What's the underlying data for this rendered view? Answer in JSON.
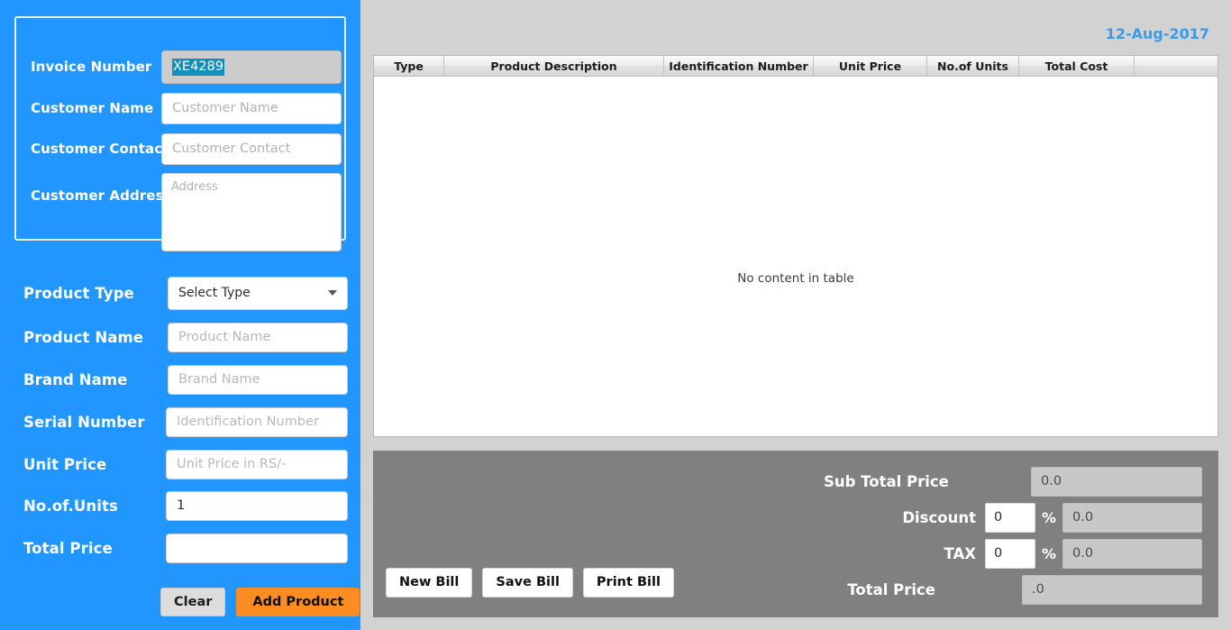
{
  "theme": {
    "sidebar_blue": "#2196ff",
    "accent_orange": "#fd8d20",
    "panel_gray": "#808080",
    "background_gray": "#d2d2d2",
    "date_blue": "#3d9ae8",
    "selection_teal": "#1290bd"
  },
  "customer": {
    "invoice_label": "Invoice Number",
    "invoice_value": "XE4289",
    "name_label": "Customer Name",
    "name_value": "",
    "name_placeholder": "Customer Name",
    "contact_label": "Customer Contact",
    "contact_value": "",
    "contact_placeholder": "Customer Contact",
    "address_label": "Customer Address",
    "address_value": "",
    "address_placeholder": "Address"
  },
  "product": {
    "type_label": "Product Type",
    "type_selected": "Select Type",
    "name_label": "Product Name",
    "name_value": "",
    "name_placeholder": "Product Name",
    "brand_label": "Brand Name",
    "brand_value": "",
    "brand_placeholder": "Brand Name",
    "serial_label": "Serial Number",
    "serial_value": "",
    "serial_placeholder": "Identification Number",
    "unit_price_label": "Unit Price",
    "unit_price_value": "",
    "unit_price_placeholder": "Unit Price in RS/-",
    "units_label": "No.of.Units",
    "units_value": "1",
    "units_placeholder": "",
    "total_price_label": "Total Price",
    "total_price_value": "",
    "total_price_placeholder": "",
    "clear_label": "Clear",
    "add_label": "Add Product"
  },
  "bill": {
    "date": "12-Aug-2017",
    "empty_message": "No content in table",
    "new_label": "New Bill",
    "save_label": "Save Bill",
    "print_label": "Print Bill"
  },
  "table": {
    "columns": [
      "Type",
      "Product Description",
      "Identification Number",
      "Unit Price",
      "No.of Units",
      "Total Cost",
      ""
    ],
    "rows": []
  },
  "summary": {
    "sub_total_label": "Sub Total Price",
    "sub_total_value": "0.0",
    "discount_label": "Discount",
    "discount_pct": "0",
    "discount_symbol": "%",
    "discount_value": "0.0",
    "tax_label": "TAX",
    "tax_pct": "0",
    "tax_symbol": "%",
    "tax_value": "0.0",
    "total_label": "Total Price",
    "total_value": ".0"
  }
}
